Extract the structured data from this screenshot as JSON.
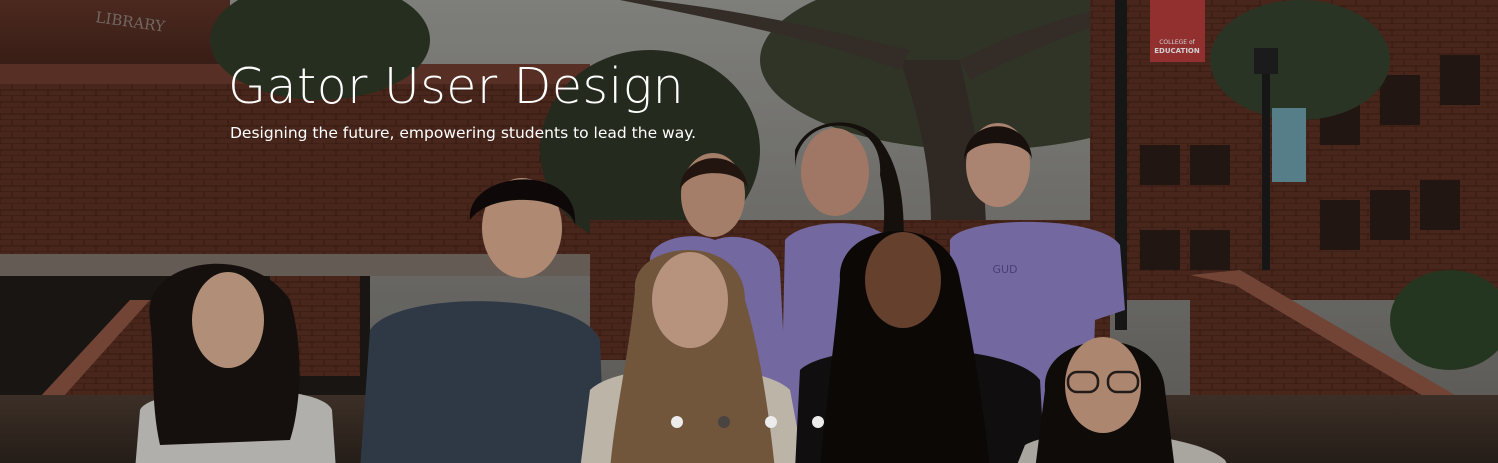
{
  "hero": {
    "title": "Gator User Design",
    "subtitle": "Designing the future, empowering students to lead the way.",
    "photo_alt": "Group photo of Gator User Design members outside a brick campus building"
  },
  "signage": {
    "building_sign": "LIBRARY",
    "banner_line1": "COLLEGE of",
    "banner_line2": "EDUCATION",
    "shirt_logo": "GUD"
  },
  "carousel": {
    "slide_count": 4,
    "active_index": 1,
    "dots": [
      {
        "label": "Slide 1",
        "active": false
      },
      {
        "label": "Slide 2",
        "active": true
      },
      {
        "label": "Slide 3",
        "active": false
      },
      {
        "label": "Slide 4",
        "active": false
      }
    ]
  },
  "colors": {
    "title_text": "#ffffff",
    "dot_inactive": "#ececec",
    "dot_active": "#4a4440",
    "shirt_purple": "#8d7fc2",
    "brick": "#6d3a2a"
  }
}
